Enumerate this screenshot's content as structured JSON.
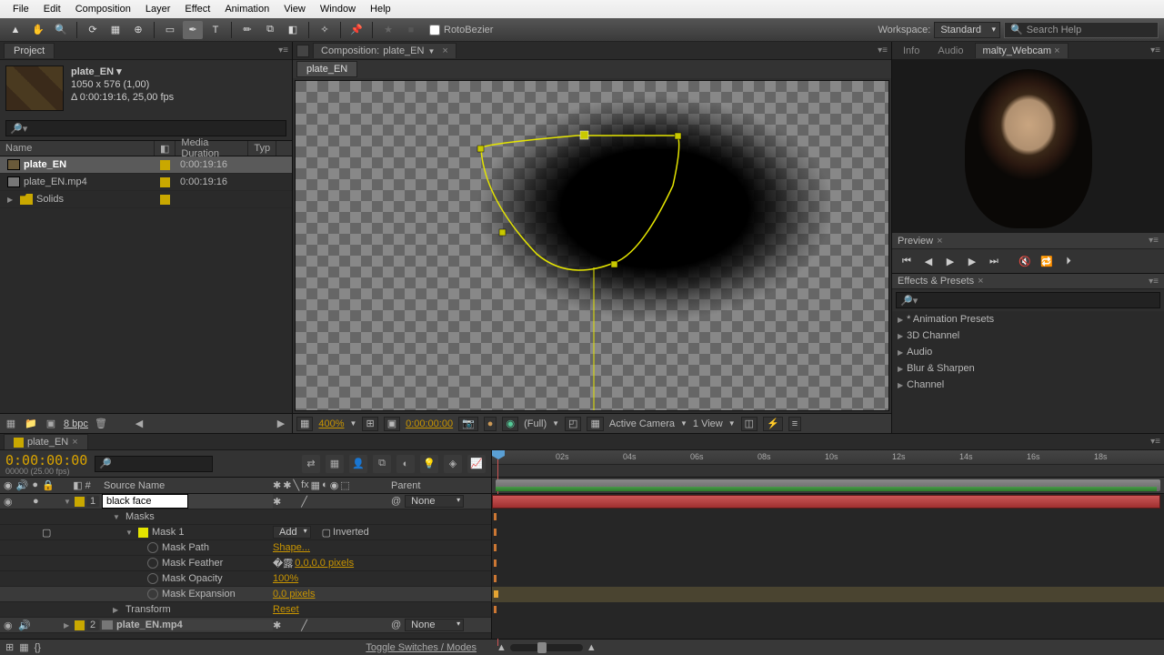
{
  "menu": [
    "File",
    "Edit",
    "Composition",
    "Layer",
    "Effect",
    "Animation",
    "View",
    "Window",
    "Help"
  ],
  "toolbar": {
    "rotobezier_label": "RotoBezier",
    "workspace_label": "Workspace:",
    "workspace_value": "Standard",
    "search_placeholder": "Search Help"
  },
  "project": {
    "tab": "Project",
    "active_name": "plate_EN ▾",
    "dimensions": "1050 x 576 (1,00)",
    "duration_fps": "Δ 0:00:19:16, 25,00 fps",
    "columns": {
      "name": "Name",
      "media": "Media Duration",
      "type": "Typ"
    },
    "items": [
      {
        "name": "plate_EN",
        "duration": "0:00:19:16",
        "icon": "comp",
        "selected": true
      },
      {
        "name": "plate_EN.mp4",
        "duration": "0:00:19:16",
        "icon": "mov",
        "selected": false
      },
      {
        "name": "Solids",
        "duration": "",
        "icon": "folder",
        "selected": false,
        "twirl": true
      }
    ],
    "bpc": "8 bpc"
  },
  "comp": {
    "tab_prefix": "Composition:",
    "tab_name": "plate_EN",
    "flow_tab": "plate_EN",
    "footer": {
      "zoom": "400%",
      "time": "0:00:00:00",
      "resolution": "(Full)",
      "camera": "Active Camera",
      "views": "1 View"
    }
  },
  "right": {
    "tabs": [
      "Info",
      "Audio",
      "malty_Webcam"
    ],
    "active_tab": 2,
    "preview_label": "Preview",
    "effects_label": "Effects & Presets",
    "effects_items": [
      "* Animation Presets",
      "3D Channel",
      "Audio",
      "Blur & Sharpen",
      "Channel"
    ]
  },
  "timeline": {
    "tab": "plate_EN",
    "timecode": "0:00:00:00",
    "timecode_sub": "00000 (25.00 fps)",
    "columns": {
      "source": "Source Name",
      "parent": "Parent"
    },
    "ruler": [
      "02s",
      "04s",
      "06s",
      "08s",
      "10s",
      "12s",
      "14s",
      "16s",
      "18s"
    ],
    "layers": [
      {
        "num": "1",
        "name": "black face",
        "color": "#c9a800",
        "parent": "None",
        "editable": true
      },
      {
        "num": "2",
        "name": "plate_EN.mp4",
        "color": "#c9a800",
        "parent": "None"
      }
    ],
    "mask_group": "Masks",
    "mask_name": "Mask 1",
    "mask_mode": "Add",
    "mask_inverted": "Inverted",
    "props": [
      {
        "name": "Mask Path",
        "value": "Shape..."
      },
      {
        "name": "Mask Feather",
        "value": "0,0,0,0 pixels",
        "linked": true
      },
      {
        "name": "Mask Opacity",
        "value": "100%"
      },
      {
        "name": "Mask Expansion",
        "value": "0,0 pixels"
      }
    ],
    "transform_label": "Transform",
    "transform_value": "Reset",
    "toggle_label": "Toggle Switches / Modes"
  }
}
